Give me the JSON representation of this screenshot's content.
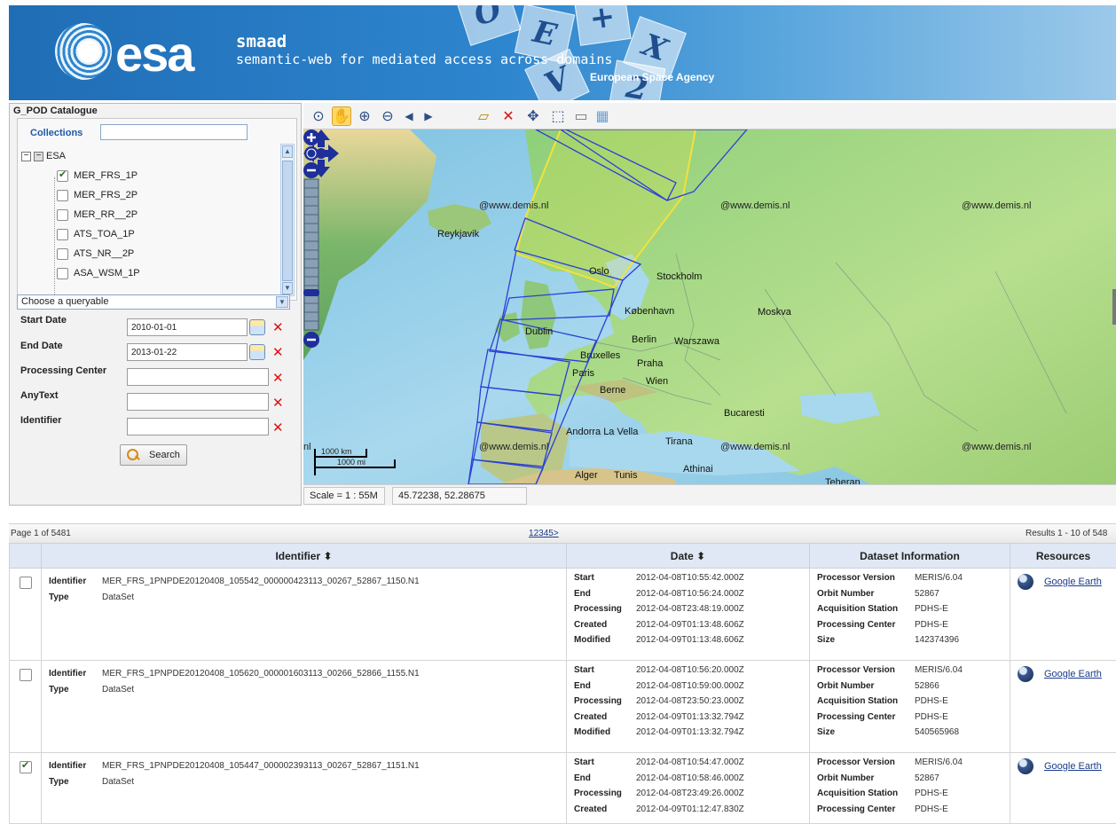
{
  "header": {
    "logo_text": "esa",
    "app_name": "smaad",
    "app_subtitle": "semantic-web for mediated access across domains",
    "agency": "European Space Agency"
  },
  "catalogue": {
    "title": "G_POD Catalogue",
    "collections_label": "Collections",
    "collections_search_value": "",
    "root": {
      "label": "ESA",
      "expanded": true
    },
    "items": [
      {
        "label": "MER_FRS_1P",
        "checked": true
      },
      {
        "label": "MER_FRS_2P",
        "checked": false
      },
      {
        "label": "MER_RR__2P",
        "checked": false
      },
      {
        "label": "ATS_TOA_1P",
        "checked": false
      },
      {
        "label": "ATS_NR__2P",
        "checked": false
      },
      {
        "label": "ASA_WSM_1P",
        "checked": false
      }
    ],
    "queryable_placeholder": "Choose a queryable",
    "fields": {
      "start_date": {
        "label": "Start Date",
        "value": "2010-01-01"
      },
      "end_date": {
        "label": "End Date",
        "value": "2013-01-22"
      },
      "processing_center": {
        "label": "Processing Center",
        "value": ""
      },
      "any_text": {
        "label": "AnyText",
        "value": ""
      },
      "identifier": {
        "label": "Identifier",
        "value": ""
      }
    },
    "search_label": "Search"
  },
  "map": {
    "cities": [
      "Reykjavik",
      "Oslo",
      "Stockholm",
      "København",
      "Moskva",
      "Dublin",
      "Berlin",
      "Warszawa",
      "Bruxelles",
      "Praha",
      "Paris",
      "Wien",
      "Berne",
      "Bucaresti",
      "Andorra La Vella",
      "Tirana",
      "Athinai",
      "Alger",
      "Tunis",
      "Teheran"
    ],
    "watermark": "@www.demis.nl",
    "watermark_fragment": "nl",
    "scale_km": "1000 km",
    "scale_mi": "1000 mi",
    "scale_text": "Scale = 1 : 55M",
    "coords_text": "45.72238, 52.28675"
  },
  "results": {
    "page_text": "Page 1 of 5481",
    "pages": [
      "1",
      "2",
      "3",
      "4",
      "5",
      ">"
    ],
    "results_text": "Results 1 - 10 of 548",
    "columns": {
      "identifier": "Identifier ⬍",
      "date": "Date ⬍",
      "dataset": "Dataset Information",
      "resources": "Resources"
    },
    "rows": [
      {
        "checked": false,
        "identifier": "MER_FRS_1PNPDE20120408_105542_000000423113_00267_52867_1150.N1",
        "type": "DataSet",
        "start": "2012-04-08T10:55:42.000Z",
        "end": "2012-04-08T10:56:24.000Z",
        "processing": "2012-04-08T23:48:19.000Z",
        "created": "2012-04-09T01:13:48.606Z",
        "modified": "2012-04-09T01:13:48.606Z",
        "processor_version": "MERIS/6.04",
        "orbit_number": "52867",
        "acquisition_station": "PDHS-E",
        "processing_center": "PDHS-E",
        "size": "142374396"
      },
      {
        "checked": false,
        "identifier": "MER_FRS_1PNPDE20120408_105620_000001603113_00266_52866_1155.N1",
        "type": "DataSet",
        "start": "2012-04-08T10:56:20.000Z",
        "end": "2012-04-08T10:59:00.000Z",
        "processing": "2012-04-08T23:50:23.000Z",
        "created": "2012-04-09T01:13:32.794Z",
        "modified": "2012-04-09T01:13:32.794Z",
        "processor_version": "MERIS/6.04",
        "orbit_number": "52866",
        "acquisition_station": "PDHS-E",
        "processing_center": "PDHS-E",
        "size": "540565968"
      },
      {
        "checked": true,
        "identifier": "MER_FRS_1PNPDE20120408_105447_000002393113_00267_52867_1151.N1",
        "type": "DataSet",
        "start": "2012-04-08T10:54:47.000Z",
        "end": "2012-04-08T10:58:46.000Z",
        "processing": "2012-04-08T23:49:26.000Z",
        "created": "2012-04-09T01:12:47.830Z",
        "modified": "",
        "processor_version": "MERIS/6.04",
        "orbit_number": "52867",
        "acquisition_station": "PDHS-E",
        "processing_center": "PDHS-E",
        "size": ""
      }
    ],
    "labels": {
      "identifier": "Identifier",
      "type": "Type",
      "start": "Start",
      "end": "End",
      "processing": "Processing",
      "created": "Created",
      "modified": "Modified",
      "processor_version": "Processor Version",
      "orbit_number": "Orbit Number",
      "acquisition_station": "Acquisition Station",
      "processing_center": "Processing Center",
      "size": "Size",
      "google_earth": "Google Earth"
    }
  },
  "colors": {
    "header_blue": "#2e86cf",
    "footprint_blue": "#2b3fd6",
    "footprint_yellow": "#f2e23a",
    "clear_red": "#d11111"
  }
}
